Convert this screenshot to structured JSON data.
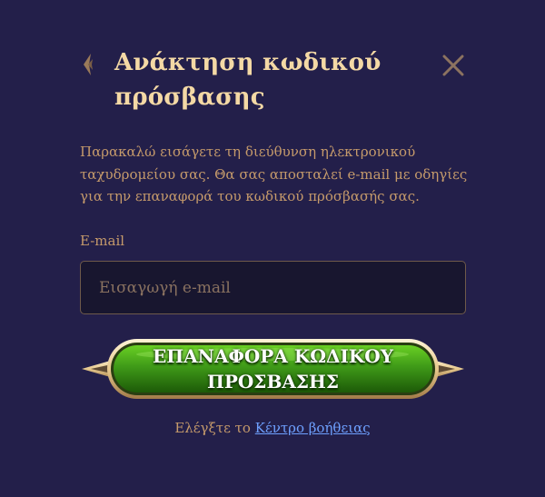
{
  "header": {
    "title": "Ανάκτηση κωδικού πρόσβασης",
    "back_icon": "chevron-left-icon",
    "close_icon": "close-icon"
  },
  "form": {
    "description": "Παρακαλώ εισάγετε τη διεύθυνση ηλεκτρονικού ταχυδρομείου σας. Θα σας αποσταλεί e-mail με οδηγίες για την επαναφορά του κωδικού πρόσβασής σας.",
    "email_label": "E-mail",
    "email_placeholder": "Εισαγωγή e-mail",
    "email_value": "",
    "submit_label": "ΕΠΑΝΑΦΟΡΑ ΚΩΔΙΚΟΥ ΠΡΟΣΒΑΣΗΣ"
  },
  "footer": {
    "help_prefix": "Ελέγξτε το",
    "help_link": "Κέντρο βοήθειας"
  },
  "colors": {
    "background": "#231f4a",
    "title": "#f4d9a5",
    "body_text": "#c59a6b",
    "input_bg": "#18162f",
    "button_green": "#3f9a18",
    "button_gold": "#e7c98e",
    "link": "#6ea0ff"
  }
}
